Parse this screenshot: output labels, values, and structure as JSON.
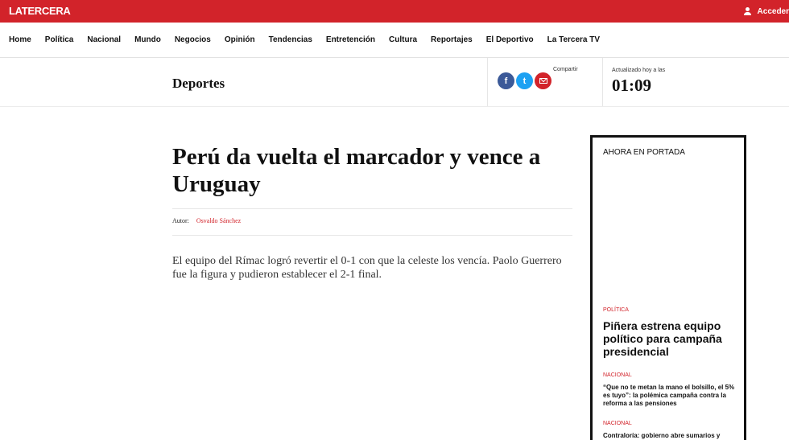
{
  "brand": {
    "logo": "LATERCERA",
    "login_label": "Acceder"
  },
  "nav": [
    "Home",
    "Política",
    "Nacional",
    "Mundo",
    "Negocios",
    "Opinión",
    "Tendencias",
    "Entretención",
    "Cultura",
    "Reportajes",
    "El Deportivo",
    "La Tercera TV"
  ],
  "section": {
    "title": "Deportes",
    "share_label": "Compartir",
    "updated_label": "Actualizado hoy a las",
    "updated_time": "01:09"
  },
  "social": {
    "facebook": "f",
    "twitter": "t"
  },
  "article": {
    "headline": "Perú da vuelta el marcador y vence a Uruguay",
    "author_label": "Autor:",
    "author_name": "Osvaldo Sánchez",
    "lead": "El equipo del Rímac logró revertir el 0-1 con que la celeste los vencía. Paolo Guerrero fue la figura y pudieron establecer el 2-1 final."
  },
  "portada": {
    "title": "AHORA EN PORTADA",
    "items": [
      {
        "category": "Política",
        "title": "Piñera estrena equipo político para campaña presidencial"
      },
      {
        "category": "Nacional",
        "title": "“Que no te metan la mano el bolsillo, el 5% es tuyo”: la polémica campaña contra la reforma a las pensiones"
      },
      {
        "category": "Nacional",
        "title": "Contraloría: gobierno abre sumarios y"
      }
    ]
  }
}
